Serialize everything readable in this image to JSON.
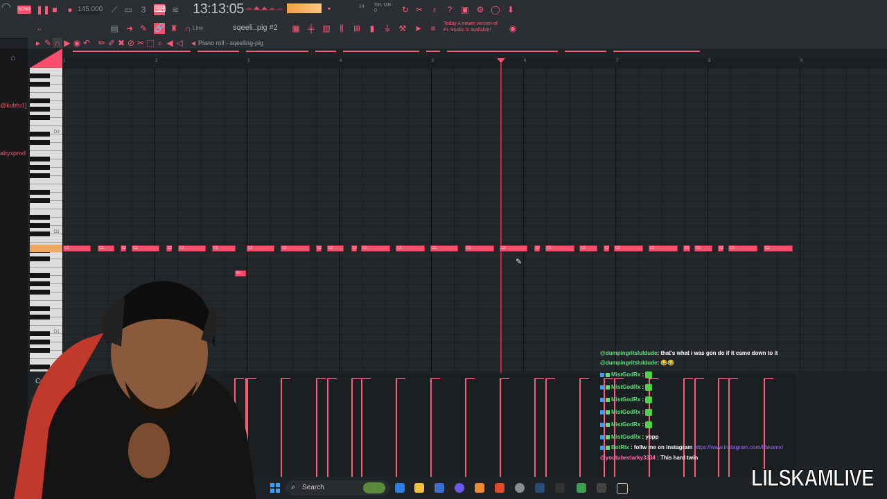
{
  "toolbar": {
    "song_mode": "SONG",
    "tempo": "145.000",
    "clock": "13:13:05",
    "cpu": "14",
    "memory": "991 MB",
    "memory_sub": "0",
    "snap": "Line",
    "pattern_name": "sqeeli..pig #2",
    "notice_line1": "Today  A newer version of",
    "notice_line2": "FL Studio is available!"
  },
  "piano_roll": {
    "title": "Piano roll - sqeeling-pig",
    "bar_numbers": [
      "1",
      "2",
      "3",
      "4",
      "5",
      "6",
      "7",
      "8",
      "9"
    ],
    "key_labels": [
      "D3",
      "D2",
      "D1"
    ],
    "note_label_main": "C2",
    "note_label_low": "A1",
    "control_label": "Control"
  },
  "side_names": [
    "@kubfu1]",
    "abyxprod"
  ],
  "chat": {
    "lines": [
      {
        "user": "@dumpingritsluldude",
        "text": ": that's what i was gon do if it came down to it",
        "color": "user"
      },
      {
        "user": "@dumpingritsluldude",
        "text": ": 😂😂",
        "color": "user"
      },
      {
        "user": "MistGodRx",
        "text": " :",
        "emote": true
      },
      {
        "user": "MistGodRx",
        "text": " :",
        "emote": true
      },
      {
        "user": "MistGodRx",
        "text": " :",
        "emote": true
      },
      {
        "user": "MistGodRx",
        "text": " :",
        "emote": true
      },
      {
        "user": "MistGodRx",
        "text": " :",
        "emote": true
      },
      {
        "user": "MistGodRx",
        "text": " : yopp"
      },
      {
        "user": "BotRix",
        "text": " : follw me on instagram ",
        "link": "https://www.instagram.com/lilskamx/"
      },
      {
        "user": "@youtubeclarky3334",
        "text": " : This hard twin",
        "color": "pink"
      }
    ]
  },
  "taskbar": {
    "search_label": "Search"
  },
  "watermark": "LILSKAMLIVE",
  "colors": {
    "accent": "#ff4d6d",
    "grid_bg": "#23272a",
    "toolbar_bg": "#2b2f33"
  }
}
